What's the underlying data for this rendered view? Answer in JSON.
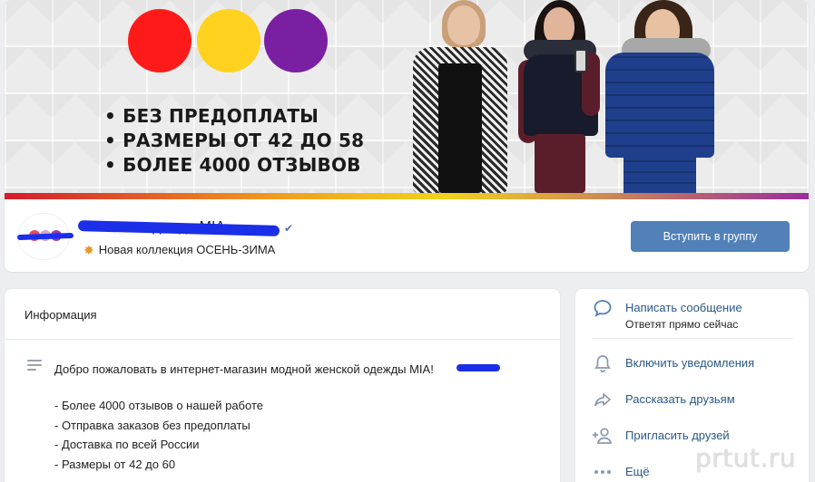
{
  "cover": {
    "bullets": [
      "БЕЗ ПРЕДОПЛАТЫ",
      "РАЗМЕРЫ ОТ 42 ДО 58",
      "БОЛЕЕ 4000 ОТЗЫВОВ"
    ],
    "dot_colors": [
      "#ff1a1a",
      "#ffd21f",
      "#7a1fa2"
    ]
  },
  "header": {
    "group_name": "Женская одежда MIA",
    "status": "Новая коллекция ОСЕНЬ-ЗИМА",
    "join_label": "Вступить в группу",
    "accent_color": "#5181b8"
  },
  "info": {
    "title": "Информация",
    "description": "Добро пожаловать в интернет-магазин модной женской одежды MIA!",
    "list": [
      "- Более 4000 отзывов о нашей работе",
      "- Отправка заказов без предоплаты",
      "- Доставка по всей России",
      "- Размеры от 42 до 60"
    ]
  },
  "actions": [
    {
      "label": "Написать сообщение",
      "sub": "Ответят прямо сейчас",
      "icon": "message-bubble-icon"
    },
    {
      "label": "Включить уведомления",
      "icon": "bell-icon"
    },
    {
      "label": "Рассказать друзьям",
      "icon": "share-arrow-icon"
    },
    {
      "label": "Пригласить друзей",
      "icon": "add-user-icon"
    },
    {
      "label": "Ещё",
      "icon": "more-dots-icon"
    }
  ],
  "watermark": "prtut.ru"
}
